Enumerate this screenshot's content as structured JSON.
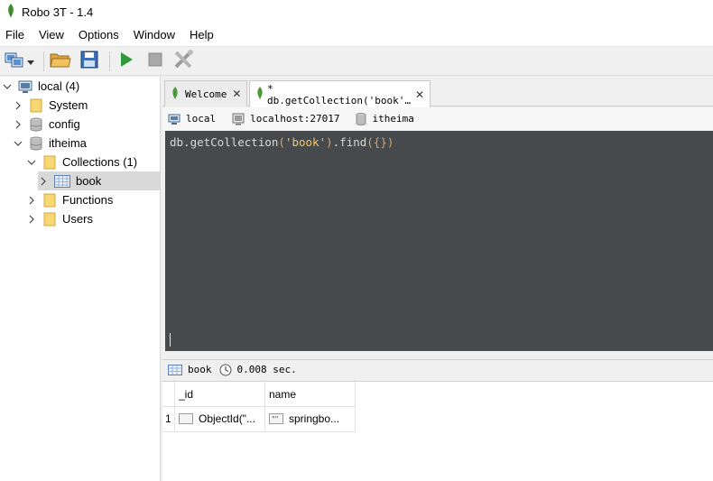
{
  "window": {
    "title": "Robo 3T - 1.4"
  },
  "menubar": {
    "items": [
      "File",
      "View",
      "Options",
      "Window",
      "Help"
    ]
  },
  "toolbar": {
    "icons": [
      "connect-icon",
      "dropdown-arrow-icon",
      "open-folder-icon",
      "save-icon",
      "execute-icon",
      "stop-icon",
      "tools-icon"
    ]
  },
  "tree": {
    "server": {
      "label": "local (4)"
    },
    "databases": [
      {
        "label": "System"
      },
      {
        "label": "config"
      },
      {
        "label": "itheima"
      }
    ],
    "collections": {
      "label": "Collections (1)"
    },
    "collection_items": [
      {
        "label": "book"
      }
    ],
    "functions": {
      "label": "Functions"
    },
    "users": {
      "label": "Users"
    }
  },
  "tabs": [
    {
      "label": "Welcome"
    },
    {
      "label": "* db.getCollection('book'…"
    }
  ],
  "info": {
    "server": "local",
    "host": "localhost:27017",
    "database": "itheima"
  },
  "editor": {
    "prefix": "db.getCollection",
    "open": "(",
    "string": "'book'",
    "close": ")",
    "method": ".find",
    "args": "({})"
  },
  "result": {
    "collection": "book",
    "time": "0.008 sec.",
    "columns": [
      "_id",
      "name"
    ],
    "rows": [
      {
        "index": "1",
        "_id": "ObjectId(\"...",
        "name": "springbo..."
      }
    ]
  },
  "colors": {
    "editor_bg": "#464a4d",
    "mongo_green": "#4c9a3a",
    "folder_yellow": "#f7d774"
  }
}
